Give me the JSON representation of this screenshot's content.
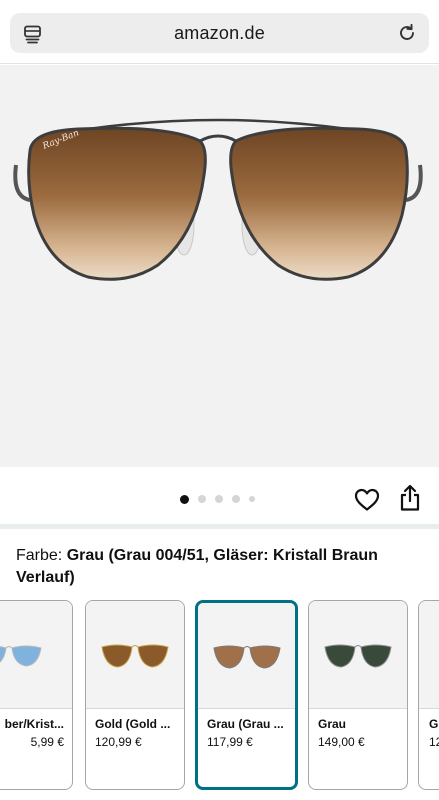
{
  "browser": {
    "url": "amazon.de",
    "tabs_icon": "tabs-icon",
    "reload_icon": "reload-icon"
  },
  "gallery": {
    "image_icon": "aviator-sunglasses-brown",
    "logo_text": "Ray-Ban",
    "dots_count": 5,
    "active_dot": 0
  },
  "actions": {
    "favorite_icon": "heart-icon",
    "share_icon": "share-icon"
  },
  "color": {
    "label": "Farbe: ",
    "value": "Grau (Grau 004/51, Gläser: Kristall Braun Verlauf)"
  },
  "variants": [
    {
      "name": "ber/Krist...",
      "price": "5,99 €",
      "lens": "#7fb3de",
      "frame": "#b8b8b8"
    },
    {
      "name": "Gold (Gold ...",
      "price": "120,99 €",
      "lens": "#8a5a2b",
      "frame": "#c9a24a"
    },
    {
      "name": "Grau (Grau ...",
      "price": "117,99 €",
      "lens": "#a0704a",
      "frame": "#7a7a7a",
      "selected": true
    },
    {
      "name": "Grau",
      "price": "149,00 €",
      "lens": "#3a4a3a",
      "frame": "#8c8c8c"
    },
    {
      "name": "Gr",
      "price": "12",
      "lens": "#555555",
      "frame": "#999999"
    }
  ],
  "colors": {
    "accent": "#007185",
    "text": "#0f1111"
  }
}
